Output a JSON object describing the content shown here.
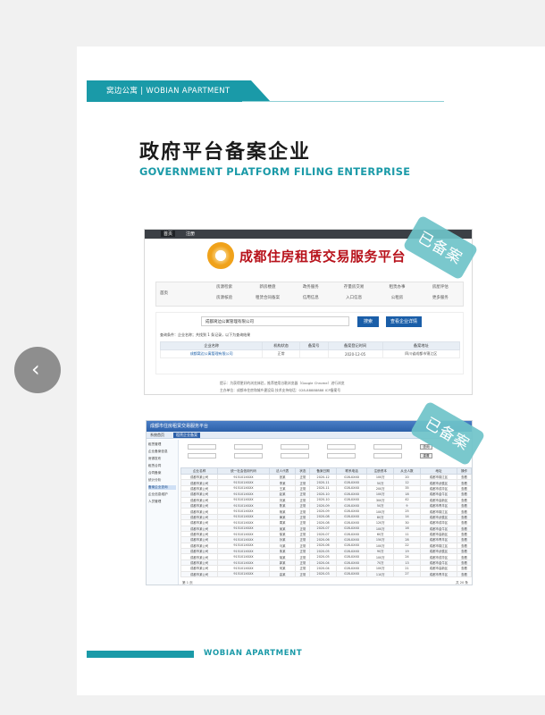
{
  "brand": {
    "banner": "窝边公寓 | WOBIAN APARTMENT",
    "footer": "WOBIAN APARTMENT"
  },
  "heading": {
    "cn": "政府平台备案企业",
    "en": "GOVERNMENT PLATFORM FILING ENTERPRISE"
  },
  "stamp": "已备案",
  "platform": {
    "top_tabs": [
      "首页",
      "注册"
    ],
    "title": "成都住房租赁交易服务平台",
    "nav_home": "首页",
    "nav_items": [
      "房源检索",
      "新房楼盘",
      "政务服务",
      "存量房交易",
      "租赁办事",
      "房屋评估",
      "房源核验",
      "租赁合同备案",
      "信用信息",
      "入口信息",
      "公租房",
      "更多服务"
    ],
    "search_value": "成都窝边公寓管理有限公司",
    "search_button": "搜索",
    "detail_button": "查看企业详情",
    "result_note": "查询条件：企业名称；共找到 1 条记录，以下为查询结果",
    "table_headers": [
      "企业名称",
      "机构状态",
      "备案号",
      "备案登记时间",
      "备案地址"
    ],
    "table_row": [
      "成都窝边公寓管理有限公司",
      "正常",
      "",
      "2020-12-05",
      "四川省成都市锦江区"
    ],
    "footer_line1": "提示：为获得更好的浏览体验，推荐使用谷歌浏览器（Google Chrome）进行浏览",
    "footer_line2": "主办单位：成都市住房和城乡建设局    技术支持电话：028-88888888    ICP备案号"
  },
  "grid": {
    "title": "成都市住房租赁交易服务平台",
    "tab_label": "系统首页",
    "tab_active": "租赁企业备案",
    "side_items": [
      "租赁管理",
      "企业备案信息",
      "房源发布",
      "租赁合同",
      "合同备案",
      "统计分析",
      "备案企业查询",
      "企业信息维护",
      "人员管理"
    ],
    "headers": [
      "企业名称",
      "统一社会信用代码",
      "法人代表",
      "状态",
      "备案日期",
      "联系电话",
      "注册资本",
      "从业人数",
      "地址",
      "操作"
    ],
    "rows": [
      [
        "成都市某公司",
        "915101XXXX",
        "张某",
        "正常",
        "2020-12",
        "028-XXXX",
        "100万",
        "20",
        "成都市锦江区",
        "查看"
      ],
      [
        "成都市某公司",
        "915101XXXX",
        "李某",
        "正常",
        "2020-11",
        "028-XXXX",
        "50万",
        "12",
        "成都市武侯区",
        "查看"
      ],
      [
        "成都市某公司",
        "915101XXXX",
        "王某",
        "正常",
        "2020-11",
        "028-XXXX",
        "200万",
        "35",
        "成都市成华区",
        "查看"
      ],
      [
        "成都市某公司",
        "915101XXXX",
        "赵某",
        "正常",
        "2020-10",
        "028-XXXX",
        "100万",
        "18",
        "成都市金牛区",
        "查看"
      ],
      [
        "成都市某公司",
        "915101XXXX",
        "刘某",
        "正常",
        "2020-10",
        "028-XXXX",
        "300万",
        "42",
        "成都市高新区",
        "查看"
      ],
      [
        "成都市某公司",
        "915101XXXX",
        "陈某",
        "正常",
        "2020-09",
        "028-XXXX",
        "50万",
        "9",
        "成都市青羊区",
        "查看"
      ],
      [
        "成都市某公司",
        "915101XXXX",
        "杨某",
        "正常",
        "2020-09",
        "028-XXXX",
        "100万",
        "25",
        "成都市锦江区",
        "查看"
      ],
      [
        "成都市某公司",
        "915101XXXX",
        "黄某",
        "正常",
        "2020-08",
        "028-XXXX",
        "80万",
        "14",
        "成都市武侯区",
        "查看"
      ],
      [
        "成都市某公司",
        "915101XXXX",
        "周某",
        "正常",
        "2020-08",
        "028-XXXX",
        "120万",
        "30",
        "成都市成华区",
        "查看"
      ],
      [
        "成都市某公司",
        "915101XXXX",
        "吴某",
        "正常",
        "2020-07",
        "028-XXXX",
        "100万",
        "16",
        "成都市金牛区",
        "查看"
      ],
      [
        "成都市某公司",
        "915101XXXX",
        "徐某",
        "正常",
        "2020-07",
        "028-XXXX",
        "60万",
        "11",
        "成都市高新区",
        "查看"
      ],
      [
        "成都市某公司",
        "915101XXXX",
        "孙某",
        "正常",
        "2020-06",
        "028-XXXX",
        "150万",
        "28",
        "成都市青羊区",
        "查看"
      ],
      [
        "成都市某公司",
        "915101XXXX",
        "马某",
        "正常",
        "2020-06",
        "028-XXXX",
        "100万",
        "22",
        "成都市锦江区",
        "查看"
      ],
      [
        "成都市某公司",
        "915101XXXX",
        "朱某",
        "正常",
        "2020-05",
        "028-XXXX",
        "90万",
        "19",
        "成都市武侯区",
        "查看"
      ],
      [
        "成都市某公司",
        "915101XXXX",
        "胡某",
        "正常",
        "2020-05",
        "028-XXXX",
        "100万",
        "24",
        "成都市成华区",
        "查看"
      ],
      [
        "成都市某公司",
        "915101XXXX",
        "郭某",
        "正常",
        "2020-04",
        "028-XXXX",
        "70万",
        "13",
        "成都市金牛区",
        "查看"
      ],
      [
        "成都市某公司",
        "915101XXXX",
        "何某",
        "正常",
        "2020-04",
        "028-XXXX",
        "100万",
        "21",
        "成都市高新区",
        "查看"
      ],
      [
        "成都市某公司",
        "915101XXXX",
        "高某",
        "正常",
        "2020-03",
        "028-XXXX",
        "110万",
        "27",
        "成都市青羊区",
        "查看"
      ]
    ],
    "query_button": "查询",
    "reset_button": "重置",
    "pager_left": "第 1 页",
    "pager_right": "共 20 条"
  },
  "nav": {
    "prev_glyph": "‹"
  }
}
